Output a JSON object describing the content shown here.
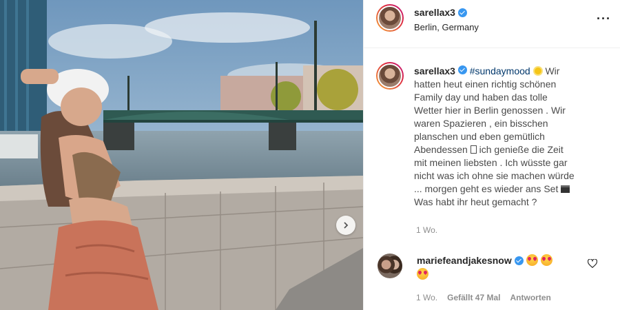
{
  "post": {
    "author": "sarellax3",
    "location": "Berlin, Germany",
    "caption": {
      "hashtag": "#sundaymood",
      "lines": [
        "hatten heut einen richtig schönen",
        "Family day und haben das tolle",
        "Wetter hier in Berlin genossen . Wir",
        "waren Spazieren , ein bisschen",
        "planschen und eben gemütlich",
        "Abendessen",
        "ich genieße die Zeit",
        "mit meinen liebsten . Ich wüsste gar",
        "nicht was ich ohne sie machen würde",
        "... morgen geht es wieder ans Set",
        "Was habt ihr heut gemacht ?"
      ],
      "first_word": "Wir"
    },
    "time_ago": "1 Wo."
  },
  "comment": {
    "author": "mariefeandjakesnow",
    "time_ago": "1 Wo.",
    "likes": "Gefällt 47 Mal",
    "reply": "Antworten"
  },
  "icons": {
    "more": "more-options-icon",
    "verified": "verified-badge-icon",
    "next": "chevron-right-icon",
    "heart": "heart-outline-icon"
  },
  "colors": {
    "accent_link": "#00376b",
    "verified": "#3897f0",
    "muted": "#8e8e8e"
  }
}
